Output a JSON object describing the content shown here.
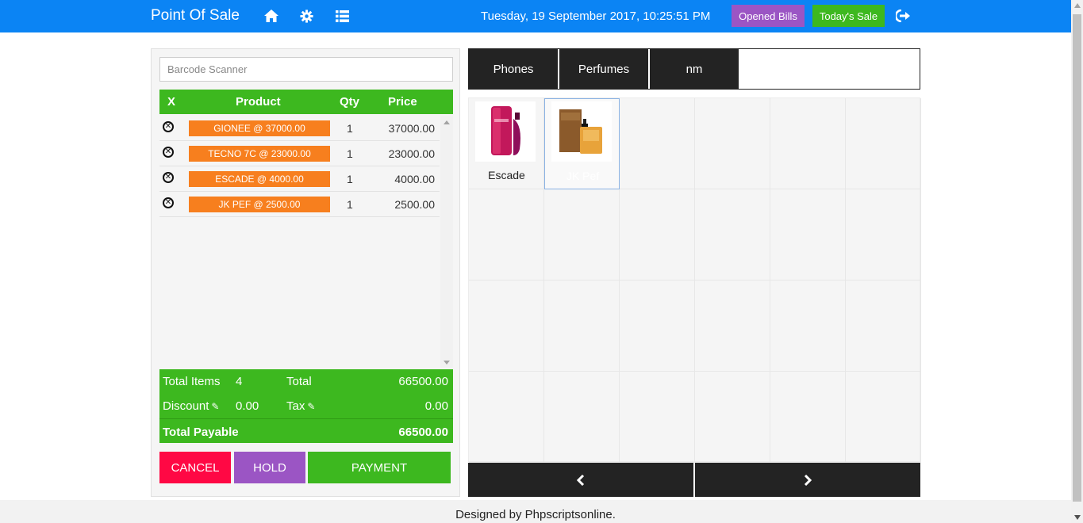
{
  "navbar": {
    "brand": "Point Of Sale",
    "datetime": "Tuesday, 19 September 2017, 10:25:51 PM",
    "opened_bills": "Opened Bills",
    "todays_sale": "Today's Sale",
    "color": "#0b84f4"
  },
  "cart": {
    "barcode_placeholder": "Barcode Scanner",
    "headers": {
      "x": "X",
      "product": "Product",
      "qty": "Qty",
      "price": "Price"
    },
    "rows": [
      {
        "product": "GIONEE @ 37000.00",
        "qty": "1",
        "price": "37000.00"
      },
      {
        "product": "TECNO 7C @ 23000.00",
        "qty": "1",
        "price": "23000.00"
      },
      {
        "product": "ESCADE @ 4000.00",
        "qty": "1",
        "price": "4000.00"
      },
      {
        "product": "JK PEF @ 2500.00",
        "qty": "1",
        "price": "2500.00"
      }
    ]
  },
  "totals": {
    "total_items_label": "Total Items",
    "total_items": "4",
    "total_label": "Total",
    "total": "66500.00",
    "discount_label": "Discount",
    "discount": "0.00",
    "tax_label": "Tax",
    "tax": "0.00",
    "payable_label": "Total Payable",
    "payable": "66500.00"
  },
  "actions": {
    "cancel": "CANCEL",
    "hold": "HOLD",
    "payment": "PAYMENT"
  },
  "categories": [
    "Phones",
    "Perfumes",
    "nm"
  ],
  "products": [
    {
      "name": "Escade"
    },
    {
      "name": "JK Pef"
    }
  ],
  "footer": "Designed by Phpscriptsonline."
}
